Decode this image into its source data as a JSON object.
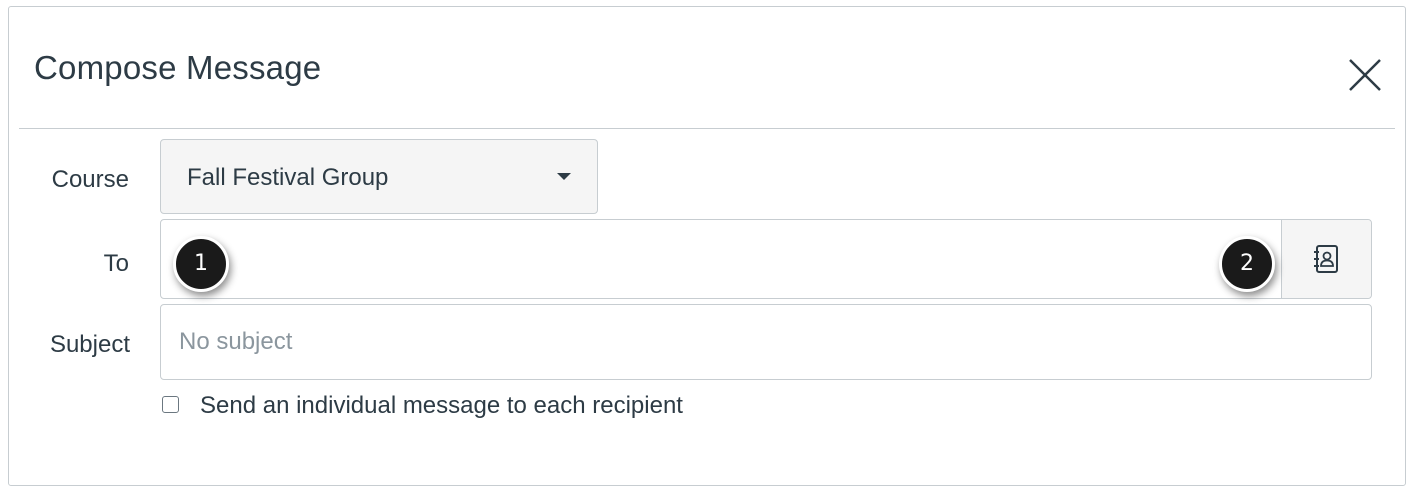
{
  "dialog": {
    "title": "Compose Message",
    "close_icon": "close-icon"
  },
  "form": {
    "course_label": "Course",
    "course_value": "Fall Festival Group",
    "to_label": "To",
    "to_value": "",
    "address_book_icon": "address-book-icon",
    "subject_label": "Subject",
    "subject_value": "",
    "subject_placeholder": "No subject",
    "individual_message_label": "Send an individual message to each recipient",
    "individual_message_checked": false
  },
  "callouts": [
    "1",
    "2"
  ],
  "colors": {
    "text": "#2d3b45",
    "border": "#c7cdd1",
    "button_bg": "#f5f5f5",
    "placeholder": "#8b969e",
    "callout_bg": "#1a1a1a"
  }
}
